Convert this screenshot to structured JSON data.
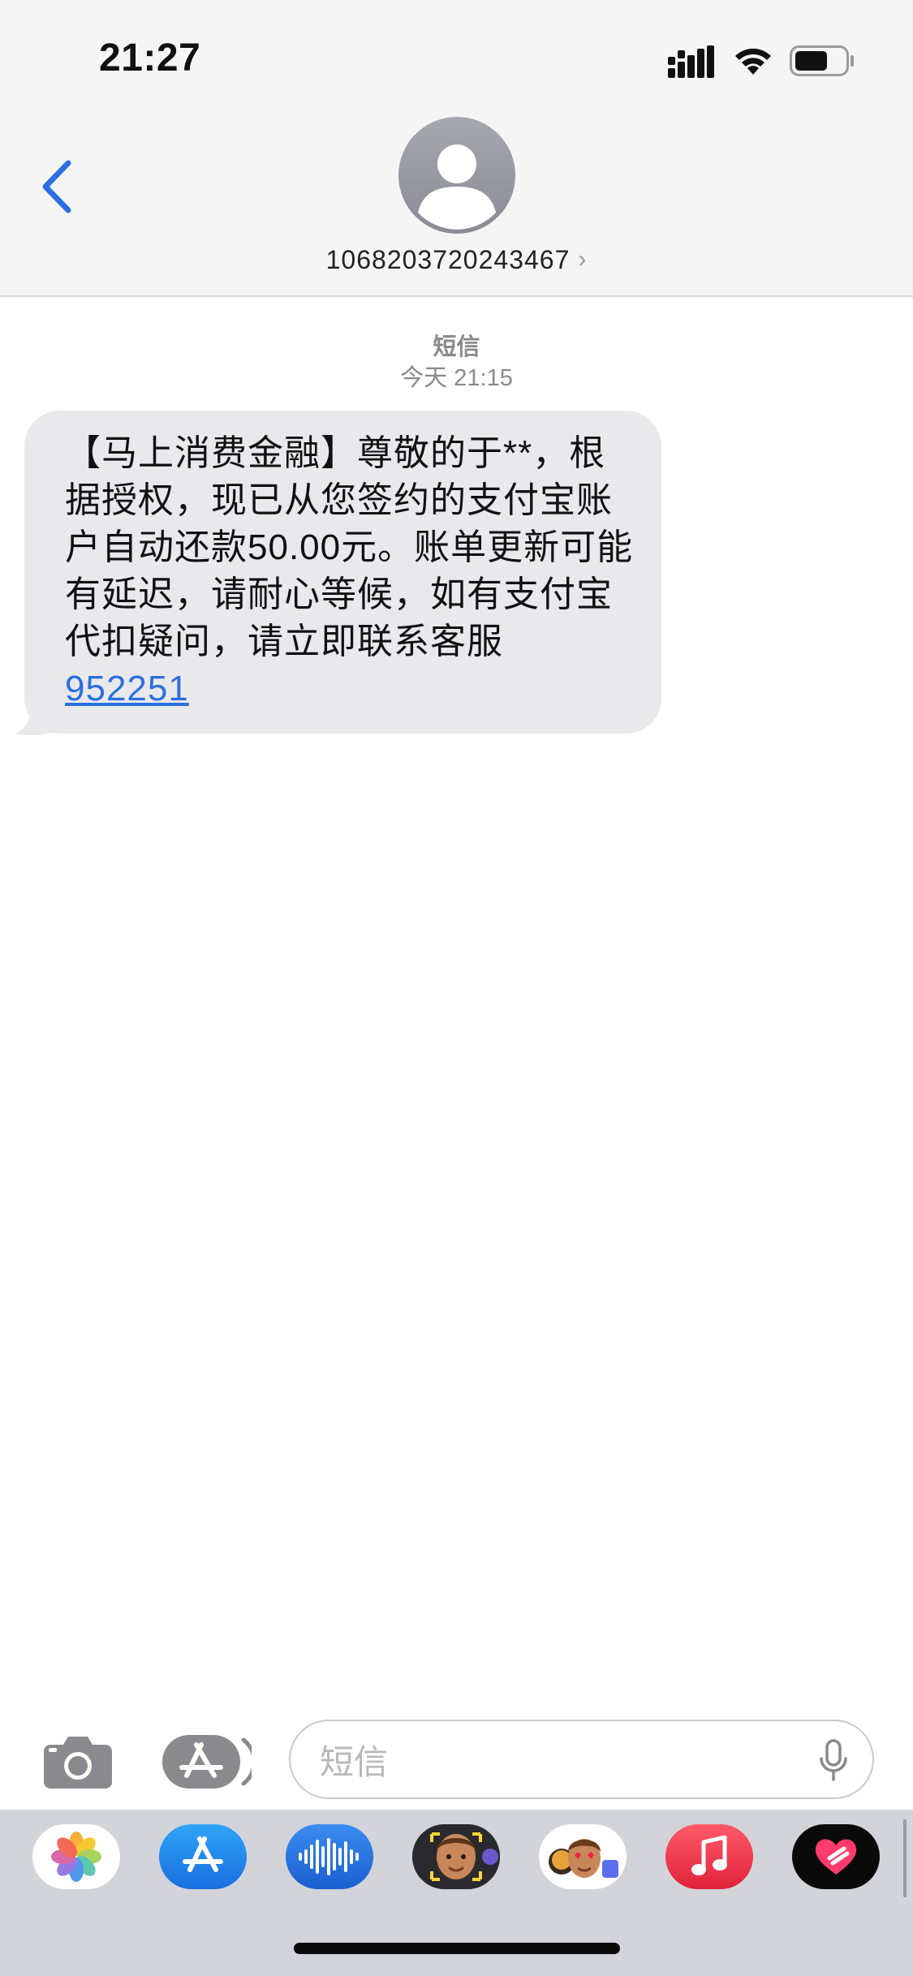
{
  "status_bar": {
    "time": "21:27"
  },
  "header": {
    "back_icon": "chevron-left-icon",
    "contact_name": "1068203720243467",
    "contact_chevron": "›"
  },
  "conversation": {
    "service": "短信",
    "time_prefix": "今天",
    "time": "21:15",
    "message": {
      "text": "【马上消费金融】尊敬的于**，根据授权，现已从您签约的支付宝账户自动还款50.00元。账单更新可能有延迟，请耐心等候，如有支付宝代扣疑问，请立即联系客服",
      "link": "952251"
    }
  },
  "input_bar": {
    "placeholder": "短信",
    "camera_icon": "camera-icon",
    "apps_icon": "app-store-icon",
    "mic_icon": "microphone-icon"
  },
  "app_drawer": {
    "apps": [
      {
        "name": "photos-app-icon"
      },
      {
        "name": "app-store-app-icon"
      },
      {
        "name": "audio-message-app-icon"
      },
      {
        "name": "memoji-app-icon"
      },
      {
        "name": "memoji-stickers-app-icon"
      },
      {
        "name": "music-app-icon"
      },
      {
        "name": "digital-touch-app-icon"
      }
    ]
  },
  "colors": {
    "accent": "#2b6fe0",
    "bubble": "#e9e9eb",
    "header_bg": "#f5f5f6",
    "drawer_bg": "#d2d4d9"
  }
}
